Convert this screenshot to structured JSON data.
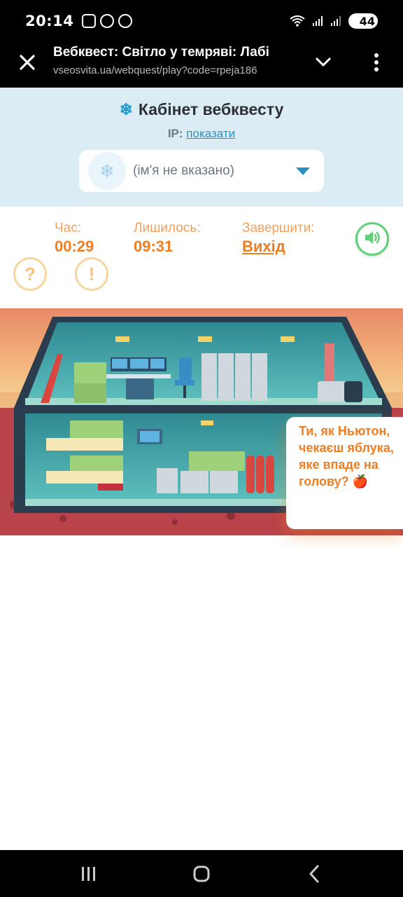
{
  "status_bar": {
    "time": "20:14",
    "battery": "44",
    "icons": [
      "screenshot-icon",
      "navigation-icon",
      "viber-icon",
      "wifi-icon",
      "signal-icon",
      "signal-icon",
      "battery-icon"
    ]
  },
  "browser": {
    "title": "Вебквест: Світло у темряві: Лабі",
    "url": "vseosvita.ua/webquest/play?code=rpeja186"
  },
  "cabinet": {
    "title": "Кабінет вебквесту",
    "ip_label": "IP:",
    "ip_link": "показати",
    "user_name": "(ім'я не вказано)"
  },
  "stats": {
    "time_label": "Час:",
    "time_value": "00:29",
    "remaining_label": "Лишилось:",
    "remaining_value": "09:31",
    "finish_label": "Завершити:",
    "finish_link": "Вихід",
    "hint_question": "?",
    "hint_exclaim": "!"
  },
  "bubble": {
    "text": "Ти, як Ньютон, чекаєш яблука, яке впаде на голову? 🍎"
  },
  "colors": {
    "accent_orange": "#ef7d22",
    "cabinet_bg": "#dcecf4",
    "sound_green": "#5fd07a",
    "link_blue": "#2c8fc4"
  }
}
